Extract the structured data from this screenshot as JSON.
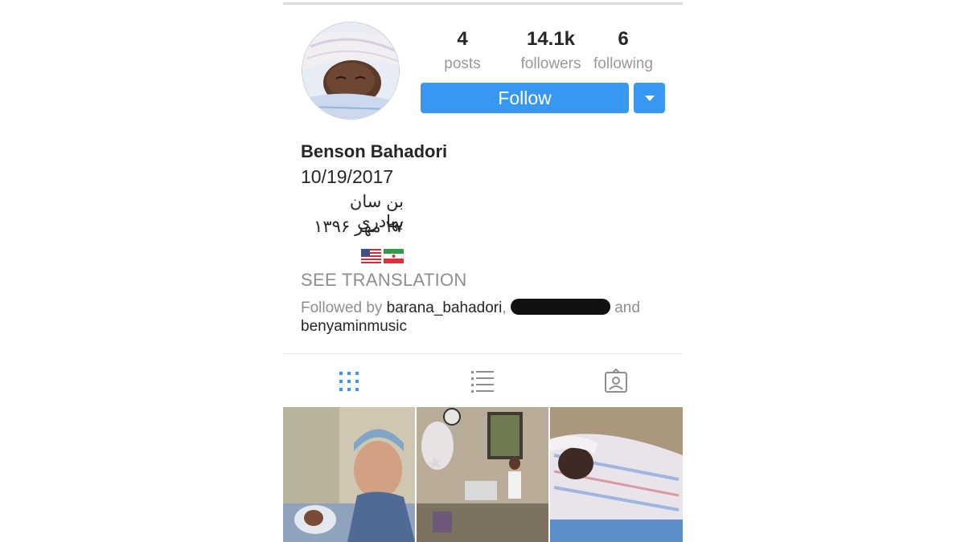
{
  "profile": {
    "stats": [
      {
        "value": "4",
        "label": "posts"
      },
      {
        "value": "14.1k",
        "label": "followers"
      },
      {
        "value": "6",
        "label": "following"
      }
    ],
    "follow_label": "Follow",
    "name": "Benson Bahadori",
    "bio_date": "10/19/2017",
    "bio_fa_name": "بن سان بهادری",
    "bio_fa_date": "۲۷ مهر ۱۳۹۶",
    "bio_flags": "🇺🇸🇮🇷",
    "see_translation": "SEE TRANSLATION",
    "followed_by_prefix": "Followed by",
    "followed_users": [
      "barana_bahadori",
      "benyaminmusic"
    ],
    "followed_sep": ",",
    "followed_and": "and"
  },
  "tabs": [
    {
      "name": "grid-view-icon",
      "active": true
    },
    {
      "name": "list-view-icon",
      "active": false
    },
    {
      "name": "tagged-photos-icon",
      "active": false
    }
  ],
  "colors": {
    "accent": "#3897f0",
    "active_tab": "#3897f0",
    "inactive_tab": "#8e8e8e",
    "muted_text": "#8e8e8e"
  }
}
